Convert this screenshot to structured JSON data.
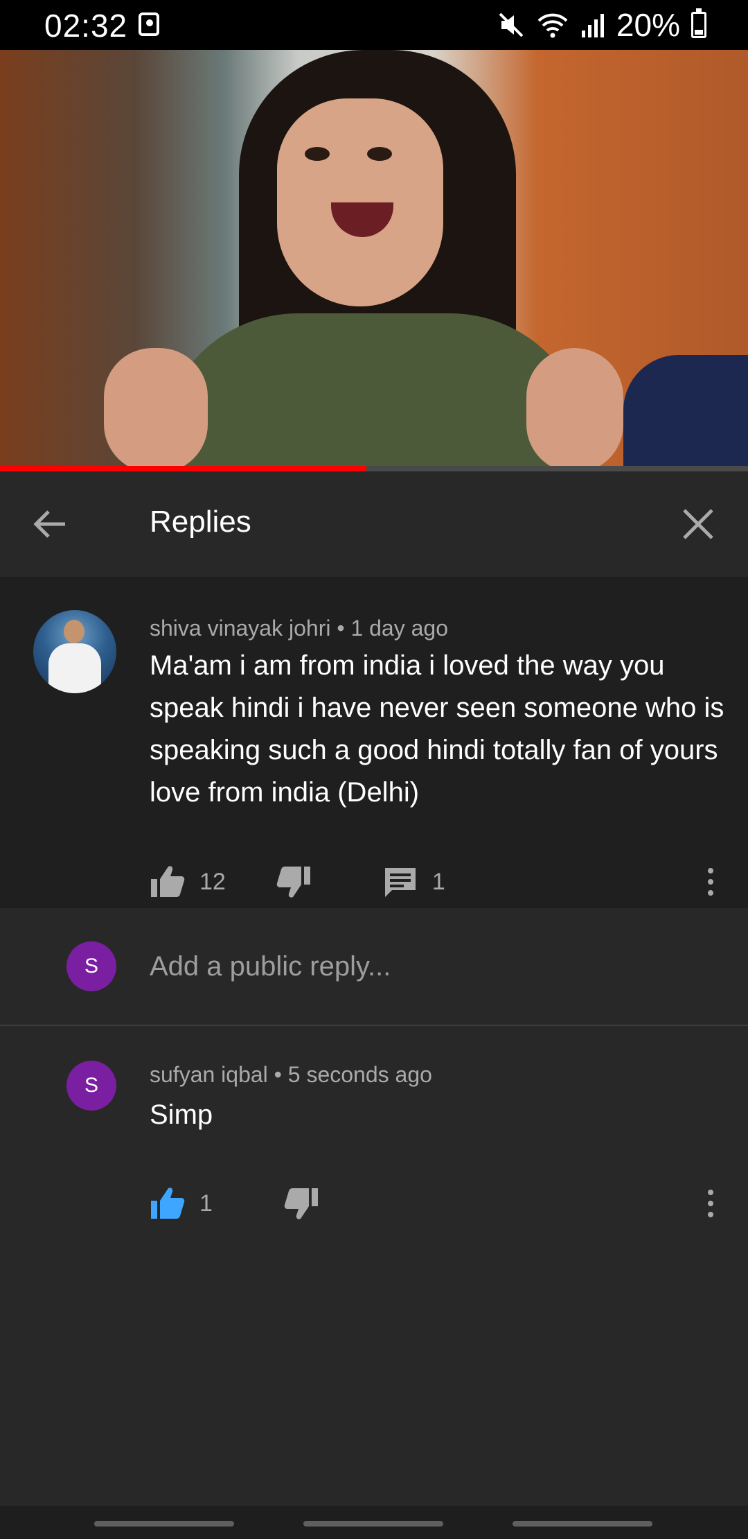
{
  "status_bar": {
    "time": "02:32",
    "battery_percent": "20%",
    "icons": [
      "alarm-icon",
      "mute-icon",
      "wifi-icon",
      "signal-icon",
      "battery-icon"
    ]
  },
  "video": {
    "progress": 0.49,
    "progress_color": "#ff0000"
  },
  "header": {
    "title": "Replies",
    "back_icon": "arrow-left-icon",
    "close_icon": "close-icon"
  },
  "parent_comment": {
    "author": "shiva vinayak johri",
    "separator": "•",
    "time": "1 day ago",
    "text": "Ma'am i am from india i loved the way you speak hindi i have never seen someone who is speaking such a good hindi totally fan of yours love from india (Delhi)",
    "likes": "12",
    "replies": "1"
  },
  "reply_box": {
    "avatar_letter": "S",
    "placeholder": "Add a public reply..."
  },
  "replies": [
    {
      "avatar_letter": "S",
      "author": "sufyan iqbal",
      "separator": "•",
      "time": "5 seconds ago",
      "text": "Simp",
      "likes": "1",
      "liked": true
    }
  ],
  "colors": {
    "accent_blue": "#3ea6ff",
    "avatar_purple": "#7b1fa2",
    "background": "#282828",
    "panel": "#1f1f1f"
  }
}
